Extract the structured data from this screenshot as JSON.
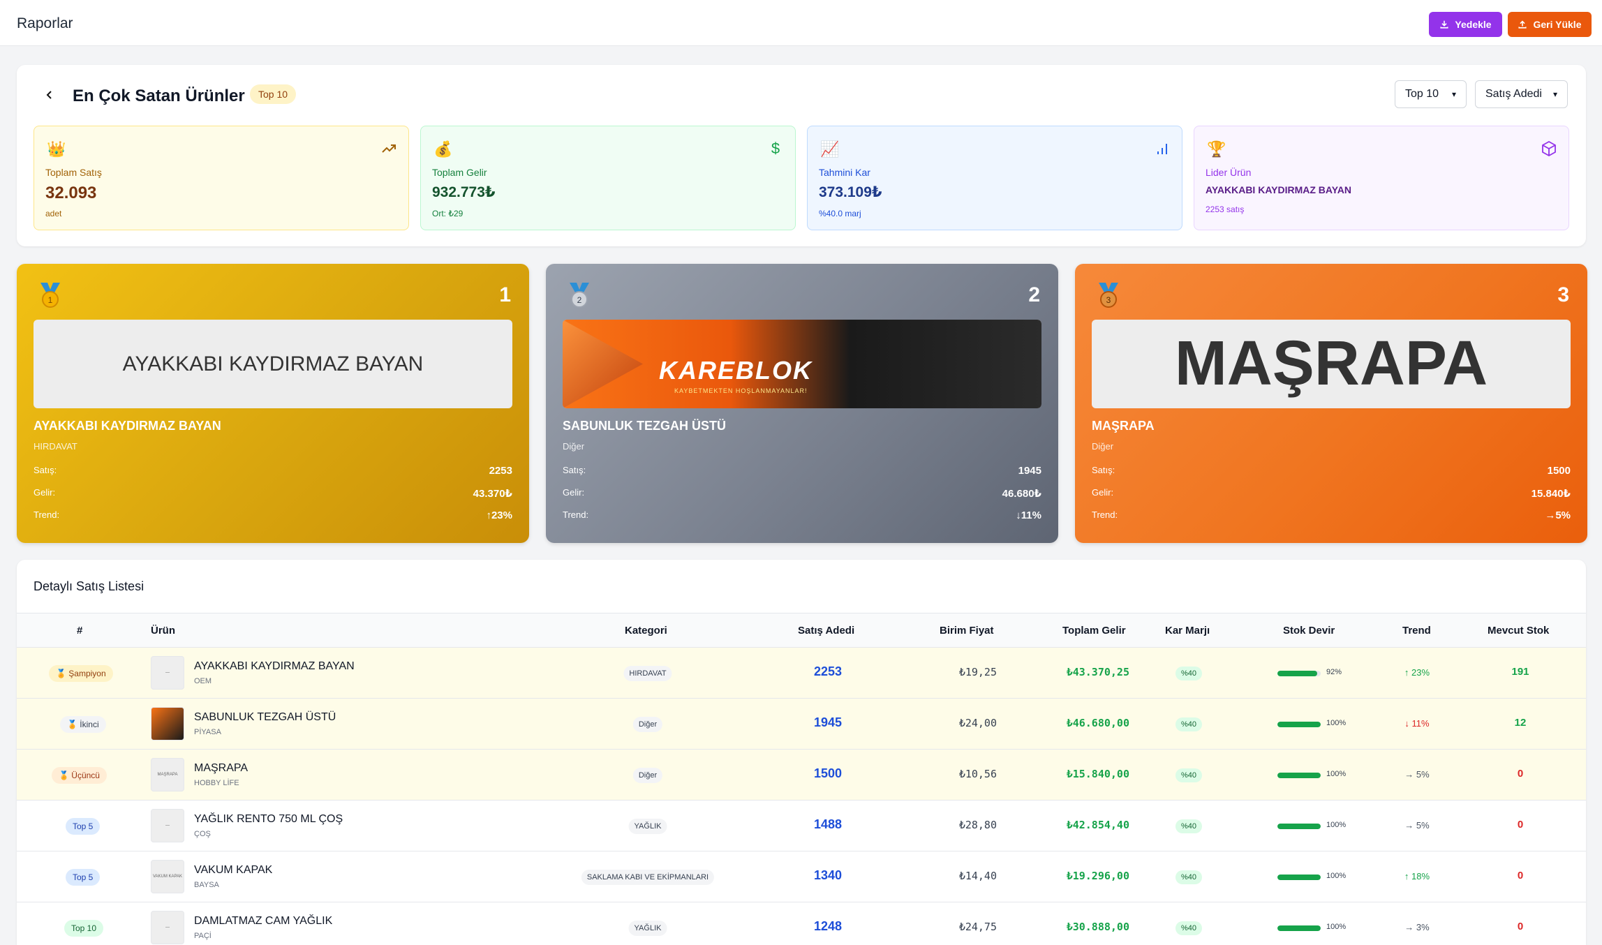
{
  "header": {
    "title": "Raporlar",
    "backup_label": "Yedekle",
    "restore_label": "Geri Yükle",
    "colors": {
      "backup": "#9333ea",
      "restore": "#ea580c"
    }
  },
  "summary": {
    "title": "En Çok Satan Ürünler",
    "badge": "Top 10",
    "top_select": "Top 10",
    "sort_select": "Satış Adedi",
    "stats": [
      {
        "icon": "crown-icon",
        "label": "Toplam Satış",
        "value": "32.093",
        "sub": "adet",
        "corner_icon": "trending-up-icon"
      },
      {
        "icon": "money-bag-icon",
        "label": "Toplam Gelir",
        "value": "932.773₺",
        "sub": "Ort: ₺29",
        "corner_icon": "dollar-icon"
      },
      {
        "icon": "chart-increasing-icon",
        "label": "Tahmini Kar",
        "value": "373.109₺",
        "sub": "%40.0 marj",
        "corner_icon": "bar-chart-icon"
      },
      {
        "icon": "trophy-icon",
        "label": "Lider Ürün",
        "value": "AYAKKABI KAYDIRMAZ BAYAN",
        "sub": "2253 satış",
        "corner_icon": "box-icon"
      }
    ]
  },
  "podium": [
    {
      "rank": "1",
      "image_text": "AYAKKABI KAYDIRMAZ BAYAN",
      "name": "AYAKKABI KAYDIRMAZ BAYAN",
      "category": "HIRDAVAT",
      "sales_label": "Satış:",
      "sales": "2253",
      "revenue_label": "Gelir:",
      "revenue": "43.370₺",
      "trend_label": "Trend:",
      "trend": "↑23%"
    },
    {
      "rank": "2",
      "image_text": "KAREBLOK",
      "image_sub": "KAYBETMEKTEN HOŞLANMAYANLAR!",
      "name": "SABUNLUK TEZGAH ÜSTÜ",
      "category": "Diğer",
      "sales_label": "Satış:",
      "sales": "1945",
      "revenue_label": "Gelir:",
      "revenue": "46.680₺",
      "trend_label": "Trend:",
      "trend": "↓11%"
    },
    {
      "rank": "3",
      "image_text": "MAŞRAPA",
      "name": "MAŞRAPA",
      "category": "Diğer",
      "sales_label": "Satış:",
      "sales": "1500",
      "revenue_label": "Gelir:",
      "revenue": "15.840₺",
      "trend_label": "Trend:",
      "trend": "→5%"
    }
  ],
  "table": {
    "title": "Detaylı Satış Listesi",
    "columns": [
      "#",
      "Ürün",
      "Kategori",
      "Satış Adedi",
      "Birim Fiyat",
      "Toplam Gelir",
      "Kar Marjı",
      "Stok Devir",
      "Trend",
      "Mevcut Stok"
    ],
    "rows": [
      {
        "rank": "🏅 Şampiyon",
        "name": "AYAKKABI KAYDIRMAZ BAYAN",
        "brand": "OEM",
        "category": "HIRDAVAT",
        "qty": "2253",
        "price": "₺19,25",
        "revenue": "₺43.370,25",
        "margin": "%40",
        "turnover": 92,
        "turnover_label": "92%",
        "trend": "↑ 23%",
        "trend_dir": "up",
        "stock": "191"
      },
      {
        "rank": "🏅 İkinci",
        "name": "SABUNLUK TEZGAH ÜSTÜ",
        "brand": "PİYASA",
        "category": "Diğer",
        "qty": "1945",
        "price": "₺24,00",
        "revenue": "₺46.680,00",
        "margin": "%40",
        "turnover": 100,
        "turnover_label": "100%",
        "trend": "↓ 11%",
        "trend_dir": "down",
        "stock": "12"
      },
      {
        "rank": "🏅 Üçüncü",
        "name": "MAŞRAPA",
        "brand": "HOBBY LİFE",
        "category": "Diğer",
        "qty": "1500",
        "price": "₺10,56",
        "revenue": "₺15.840,00",
        "margin": "%40",
        "turnover": 100,
        "turnover_label": "100%",
        "trend": "→ 5%",
        "trend_dir": "flat",
        "stock": "0"
      },
      {
        "rank": "Top 5",
        "name": "YAĞLIK RENTO 750 ML ÇOŞ",
        "brand": "ÇOŞ",
        "category": "YAĞLIK",
        "qty": "1488",
        "price": "₺28,80",
        "revenue": "₺42.854,40",
        "margin": "%40",
        "turnover": 100,
        "turnover_label": "100%",
        "trend": "→ 5%",
        "trend_dir": "flat",
        "stock": "0"
      },
      {
        "rank": "Top 5",
        "name": "VAKUM KAPAK",
        "brand": "BAYSA",
        "category": "SAKLAMA KABI VE EKİPMANLARI",
        "qty": "1340",
        "price": "₺14,40",
        "revenue": "₺19.296,00",
        "margin": "%40",
        "turnover": 100,
        "turnover_label": "100%",
        "trend": "↑ 18%",
        "trend_dir": "up",
        "stock": "0"
      },
      {
        "rank": "Top 10",
        "name": "DAMLATMAZ CAM YAĞLIK",
        "brand": "PAÇİ",
        "category": "YAĞLIK",
        "qty": "1248",
        "price": "₺24,75",
        "revenue": "₺30.888,00",
        "margin": "%40",
        "turnover": 100,
        "turnover_label": "100%",
        "trend": "→ 3%",
        "trend_dir": "flat",
        "stock": "0"
      }
    ]
  }
}
